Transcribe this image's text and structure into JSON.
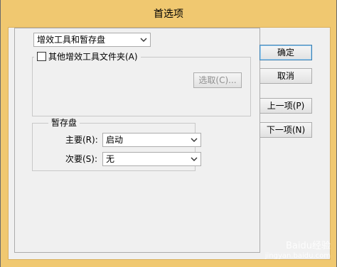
{
  "window": {
    "title": "首选项"
  },
  "category_select": {
    "value": "增效工具和暂存盘"
  },
  "plugins_group": {
    "checkbox_label": "其他增效工具文件夹(A)",
    "choose_button": "选取(C)..."
  },
  "scratch_group": {
    "legend": "暂存盘",
    "primary_label": "主要(R):",
    "primary_value": "启动",
    "secondary_label": "次要(S):",
    "secondary_value": "无"
  },
  "buttons": {
    "ok": "确定",
    "cancel": "取消",
    "prev": "上一项(P)",
    "next": "下一项(N)"
  },
  "watermark": {
    "line1": "Baidu经验",
    "line2": "jingyan.baidu.com"
  }
}
